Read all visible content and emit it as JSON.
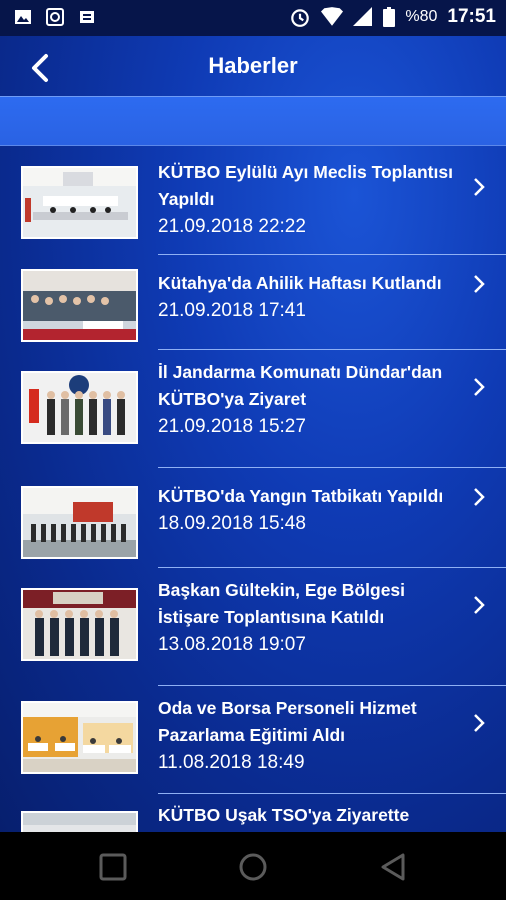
{
  "status_bar": {
    "battery": "%80",
    "time": "17:51",
    "icons": [
      "image-icon",
      "whatsapp-icon",
      "app-notification-icon",
      "alarm-icon",
      "wifi-icon",
      "signal-icon",
      "battery-icon"
    ]
  },
  "header": {
    "title": "Haberler",
    "back_icon": "chevron-left-icon"
  },
  "news": [
    {
      "title_lines": [
        "KÜTBO Eylülü Ayı Meclis Toplantısı",
        "Yapıldı"
      ],
      "date": "21.09.2018 22:22",
      "thumb": "meeting-hall"
    },
    {
      "title_lines": [
        "Kütahya'da Ahilik Haftası Kutlandı"
      ],
      "date": "21.09.2018 17:41",
      "thumb": "audience"
    },
    {
      "title_lines": [
        "İl Jandarma Komunatı Dündar'dan",
        "KÜTBO'ya Ziyaret"
      ],
      "date": "21.09.2018 15:27",
      "thumb": "group-flag"
    },
    {
      "title_lines": [
        "KÜTBO'da Yangın Tatbikatı Yapıldı"
      ],
      "date": "18.09.2018 15:48",
      "thumb": "outdoor-group"
    },
    {
      "title_lines": [
        "Başkan Gültekin, Ege Bölgesi",
        "İstişare Toplantısına Katıldı"
      ],
      "date": "13.08.2018 19:07",
      "thumb": "group-banner"
    },
    {
      "title_lines": [
        "Oda ve Borsa Personeli Hizmet",
        "Pazarlama Eğitimi Aldı"
      ],
      "date": "11.08.2018 18:49",
      "thumb": "classroom"
    },
    {
      "title_lines": [
        "KÜTBO Uşak TSO'ya Ziyarette"
      ],
      "date": "",
      "thumb": "partial"
    }
  ],
  "nav_bar": {
    "buttons": [
      "recent-apps-icon",
      "home-icon",
      "back-icon"
    ]
  }
}
